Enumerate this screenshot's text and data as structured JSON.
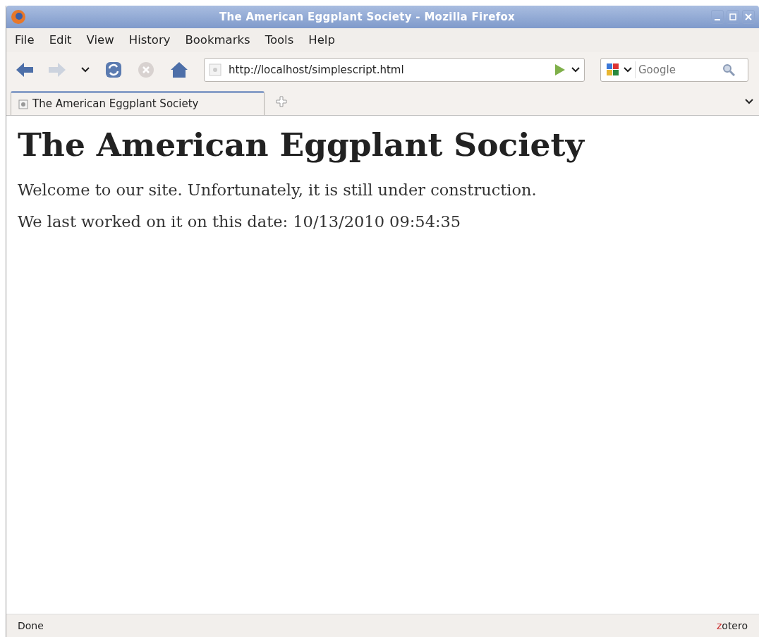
{
  "window": {
    "title": "The American Eggplant Society - Mozilla Firefox"
  },
  "menu": [
    {
      "label": "File"
    },
    {
      "label": "Edit"
    },
    {
      "label": "View"
    },
    {
      "label": "History"
    },
    {
      "label": "Bookmarks"
    },
    {
      "label": "Tools"
    },
    {
      "label": "Help"
    }
  ],
  "toolbar": {
    "back_disabled": false,
    "forward_disabled": true,
    "stop_disabled": true,
    "url": "http://localhost/simplescript.html",
    "search": {
      "placeholder": "Google"
    }
  },
  "tabs": [
    {
      "label": "The American Eggplant Society",
      "selected": true
    }
  ],
  "page": {
    "heading": "The American Eggplant Society",
    "paragraphs": [
      "Welcome to our site. Unfortunately, it is still under construction.",
      "We last worked on it on this date: 10/13/2010 09:54:35"
    ]
  },
  "status_bar": {
    "text": "Done",
    "addon": "zotero"
  }
}
